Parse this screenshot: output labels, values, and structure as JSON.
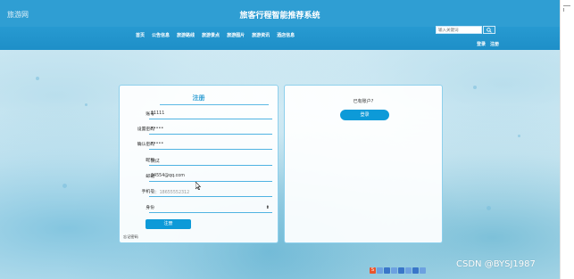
{
  "header": {
    "logo_text": "旅游网",
    "site_title": "旅客行程智能推荐系统",
    "nav": [
      "首页",
      "公告信息",
      "旅游路线",
      "旅游景点",
      "旅游图片",
      "旅游资讯",
      "酒店信息"
    ],
    "search": {
      "placeholder": "输入关键词"
    },
    "auth": {
      "login": "登录",
      "register": "注册"
    }
  },
  "register_form": {
    "title": "注册",
    "fields": [
      {
        "label": "账号",
        "value": "11111"
      },
      {
        "label": "设置密码",
        "value": "•••••"
      },
      {
        "label": "确认密码",
        "value": "•••••"
      },
      {
        "label": "昵称",
        "value": "测试"
      },
      {
        "label": "邮箱",
        "value": "34554@qq.com"
      },
      {
        "label": "手机号",
        "value": "",
        "placeholder": "如：18655552312"
      },
      {
        "label": "身份",
        "value": ""
      }
    ],
    "submit": "注册",
    "forgot": "忘记密码"
  },
  "login_panel": {
    "prompt": "已有账户?",
    "button": "登录"
  },
  "watermark": "CSDN @BYSJ1987",
  "colors": {
    "header": "#2f9ed3",
    "accent": "#0d9ad8",
    "field_line": "#4fb3e2"
  }
}
